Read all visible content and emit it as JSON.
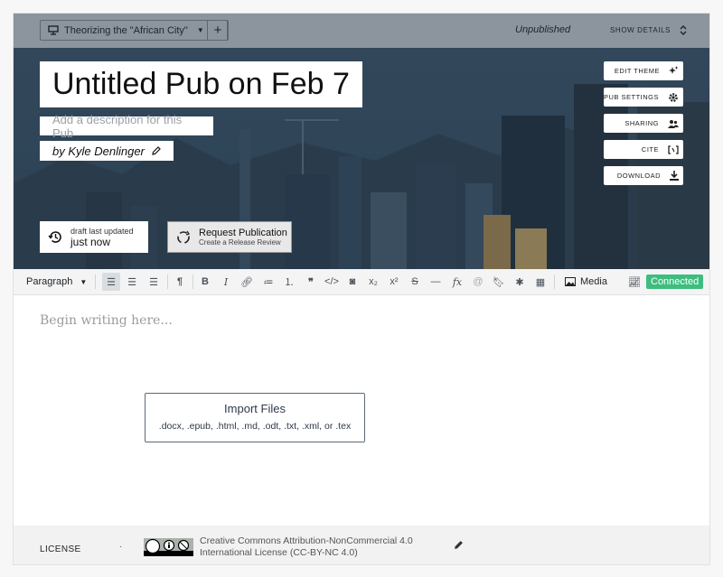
{
  "topbar": {
    "collection_label": "Theorizing the \"African City\"",
    "add_label": "+",
    "status": "Unpublished",
    "show_details": "SHOW DETAILS"
  },
  "header": {
    "title": "Untitled Pub on Feb 7",
    "description_placeholder": "Add a description for this Pub",
    "byline": "by Kyle Denlinger",
    "buttons": [
      {
        "label": "EDIT THEME",
        "icon": "sparkle-icon"
      },
      {
        "label": "PUB SETTINGS",
        "icon": "gear-icon"
      },
      {
        "label": "SHARING",
        "icon": "people-icon"
      },
      {
        "label": "CITE",
        "icon": "brackets-icon"
      },
      {
        "label": "DOWNLOAD",
        "icon": "download-icon"
      }
    ],
    "draft_label": "draft last updated",
    "draft_time": "just now",
    "request_title": "Request Publication",
    "request_subtitle": "Create a Release Review"
  },
  "toolbar": {
    "block_type": "Paragraph",
    "media_label": "Media",
    "status": "Connected",
    "status_color": "#3ebd7e"
  },
  "editor": {
    "placeholder": "Begin writing here...",
    "import_title": "Import Files",
    "import_types": ".docx, .epub, .html, .md, .odt, .txt, .xml, or .tex"
  },
  "footer": {
    "license_label": "LICENSE",
    "separator": "·",
    "license_text": "Creative Commons Attribution-NonCommercial 4.0 International License (CC-BY-NC 4.0)"
  }
}
